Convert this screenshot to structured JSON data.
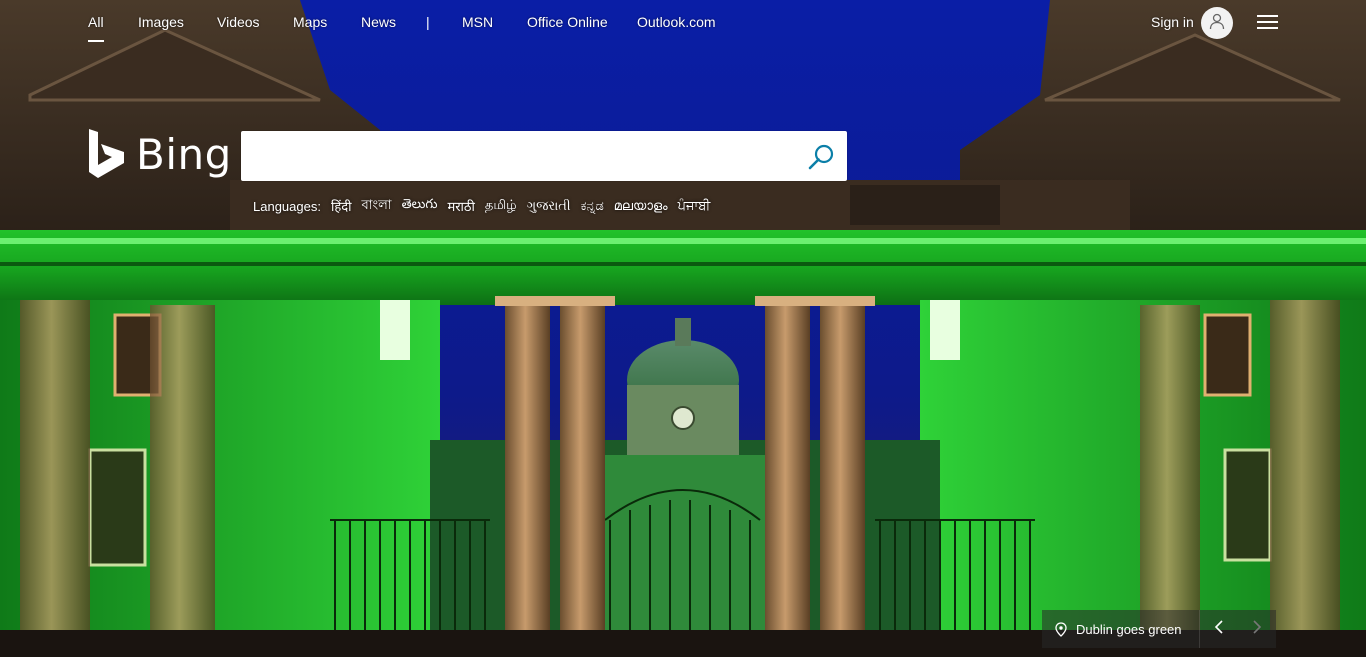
{
  "nav": {
    "items": [
      {
        "label": "All",
        "active": true
      },
      {
        "label": "Images"
      },
      {
        "label": "Videos"
      },
      {
        "label": "Maps"
      },
      {
        "label": "News"
      }
    ],
    "separator": "|",
    "extra": [
      {
        "label": "MSN"
      },
      {
        "label": "Office Online"
      },
      {
        "label": "Outlook.com"
      }
    ],
    "signin": "Sign in"
  },
  "logo": {
    "text": "Bing"
  },
  "search": {
    "value": "",
    "placeholder": ""
  },
  "languages": {
    "label": "Languages:",
    "items": [
      "हिंदी",
      "বাংলা",
      "తెలుగు",
      "मराठी",
      "தமிழ்",
      "ગુજરાતી",
      "ಕನ್ನಡ",
      "മലയാളം",
      "ਪੰਜਾਬੀ"
    ]
  },
  "caption": {
    "text": "Dublin goes green"
  },
  "colors": {
    "sky": "#0b1f8c",
    "building_green": "#3ecb3e",
    "building_stone": "#caa07a"
  },
  "icons": [
    "search-icon",
    "user-icon",
    "hamburger-icon",
    "location-pin-icon",
    "chevron-left-icon",
    "chevron-right-icon"
  ]
}
